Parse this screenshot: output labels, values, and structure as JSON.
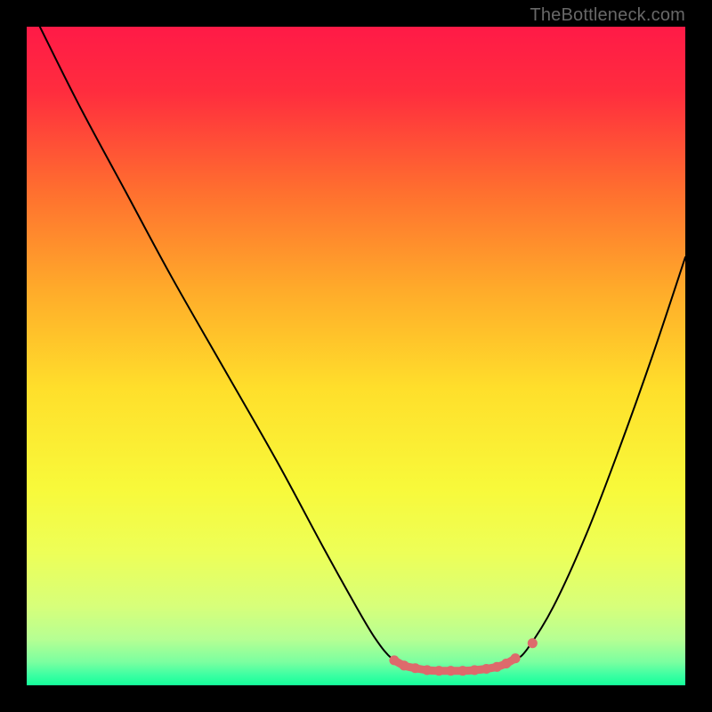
{
  "watermark": "TheBottleneck.com",
  "colors": {
    "frame": "#000000",
    "watermark_text": "#686868",
    "curve_stroke": "#000000",
    "marker_stroke": "#dd6a6c",
    "marker_fill": "#dd6a6c",
    "gradient_stops": [
      {
        "offset": 0.0,
        "color": "#ff1a47"
      },
      {
        "offset": 0.1,
        "color": "#ff2d3e"
      },
      {
        "offset": 0.25,
        "color": "#ff6f2f"
      },
      {
        "offset": 0.4,
        "color": "#ffab2a"
      },
      {
        "offset": 0.55,
        "color": "#ffdf2b"
      },
      {
        "offset": 0.7,
        "color": "#f8f93a"
      },
      {
        "offset": 0.8,
        "color": "#edff58"
      },
      {
        "offset": 0.88,
        "color": "#d7ff7a"
      },
      {
        "offset": 0.93,
        "color": "#b6ff93"
      },
      {
        "offset": 0.965,
        "color": "#7affa0"
      },
      {
        "offset": 0.985,
        "color": "#3bffa2"
      },
      {
        "offset": 1.0,
        "color": "#15ff9a"
      }
    ]
  },
  "chart_data": {
    "type": "line",
    "title": "",
    "xlabel": "",
    "ylabel": "",
    "xlim": [
      0,
      100
    ],
    "ylim": [
      0,
      100
    ],
    "note": "Axes are unlabeled; values are in percent of plot width/height. y increases downward (0 = top red, 100 = bottom green).",
    "series": [
      {
        "name": "curve",
        "x": [
          2,
          8,
          15,
          22,
          30,
          38,
          45,
          50,
          53,
          55.5,
          58,
          61,
          65,
          69,
          72,
          74,
          76,
          80,
          85,
          90,
          95,
          100
        ],
        "y": [
          0,
          12,
          25,
          38,
          52,
          66,
          79,
          88,
          93,
          96,
          97.3,
          97.7,
          97.8,
          97.6,
          97.1,
          96.2,
          94.5,
          88,
          77,
          64,
          50,
          35
        ]
      }
    ],
    "annotations": {
      "valley_segment_x": [
        55.5,
        74.2
      ],
      "valley_markers": [
        {
          "x": 55.8,
          "y": 96.2
        },
        {
          "x": 57.3,
          "y": 97.0
        },
        {
          "x": 59.0,
          "y": 97.4
        },
        {
          "x": 60.8,
          "y": 97.7
        },
        {
          "x": 62.6,
          "y": 97.8
        },
        {
          "x": 64.4,
          "y": 97.8
        },
        {
          "x": 66.2,
          "y": 97.8
        },
        {
          "x": 68.0,
          "y": 97.7
        },
        {
          "x": 69.8,
          "y": 97.5
        },
        {
          "x": 71.4,
          "y": 97.2
        },
        {
          "x": 72.8,
          "y": 96.7
        },
        {
          "x": 74.2,
          "y": 95.9
        }
      ],
      "extra_marker": {
        "x": 76.8,
        "y": 93.6
      }
    }
  }
}
